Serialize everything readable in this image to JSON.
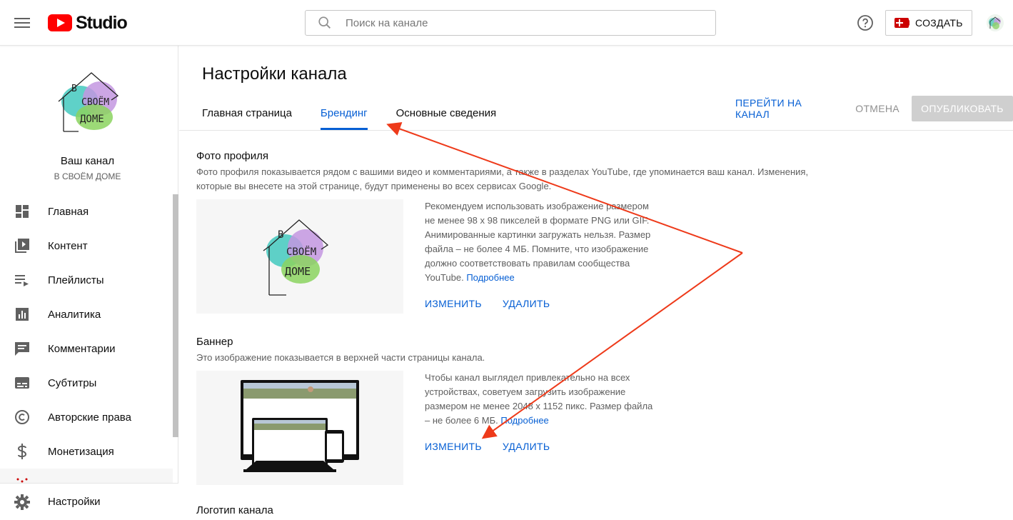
{
  "header": {
    "logo_text": "Studio",
    "search_placeholder": "Поиск на канале",
    "create_label": "СОЗДАТЬ"
  },
  "sidebar": {
    "channel_name": "Ваш канал",
    "channel_subtitle": "В СВОЁМ ДОМЕ",
    "logo_text": [
      "В",
      "СВОЁМ",
      "ДОМЕ"
    ],
    "items": [
      {
        "label": "Главная",
        "icon": "dashboard-icon"
      },
      {
        "label": "Контент",
        "icon": "video-library-icon"
      },
      {
        "label": "Плейлисты",
        "icon": "playlist-icon"
      },
      {
        "label": "Аналитика",
        "icon": "analytics-icon"
      },
      {
        "label": "Комментарии",
        "icon": "comments-icon"
      },
      {
        "label": "Субтитры",
        "icon": "subtitles-icon"
      },
      {
        "label": "Авторские права",
        "icon": "copyright-icon"
      },
      {
        "label": "Монетизация",
        "icon": "dollar-icon"
      },
      {
        "label": "Настройки",
        "icon": "gear-icon"
      }
    ]
  },
  "main": {
    "title": "Настройки канала",
    "tabs": [
      {
        "label": "Главная страница",
        "active": false
      },
      {
        "label": "Брендинг",
        "active": true
      },
      {
        "label": "Основные сведения",
        "active": false
      }
    ],
    "actions": {
      "go_to_channel": "ПЕРЕЙТИ НА КАНАЛ",
      "cancel": "ОТМЕНА",
      "publish": "ОПУБЛИКОВАТЬ"
    },
    "profile_photo": {
      "title": "Фото профиля",
      "description": "Фото профиля показывается рядом с вашими видео и комментариями, а также в разделах YouTube, где упоминается ваш канал. Изменения, которые вы внесете на этой странице, будут применены во всех сервисах Google.",
      "info": "Рекомендуем использовать изображение размером не менее 98 x 98 пикселей в формате PNG или GIF. Анимированные картинки загружать нельзя. Размер файла – не более 4 МБ. Помните, что изображение должно соответствовать правилам сообщества YouTube.",
      "more_link": "Подробнее",
      "change": "ИЗМЕНИТЬ",
      "delete": "УДАЛИТЬ"
    },
    "banner": {
      "title": "Баннер",
      "description": "Это изображение показывается в верхней части страницы канала.",
      "info": "Чтобы канал выглядел привлекательно на всех устройствах, советуем загрузить изображение размером не менее 2048 x 1152 пикс. Размер файла – не более 6 МБ.",
      "more_link": "Подробнее",
      "change": "ИЗМЕНИТЬ",
      "delete": "УДАЛИТЬ"
    },
    "logo_section": {
      "title": "Логотип канала"
    }
  },
  "colors": {
    "accent": "#065fd4",
    "brand_red": "#ff0000",
    "annotation_arrow": "#ee3a1a"
  }
}
